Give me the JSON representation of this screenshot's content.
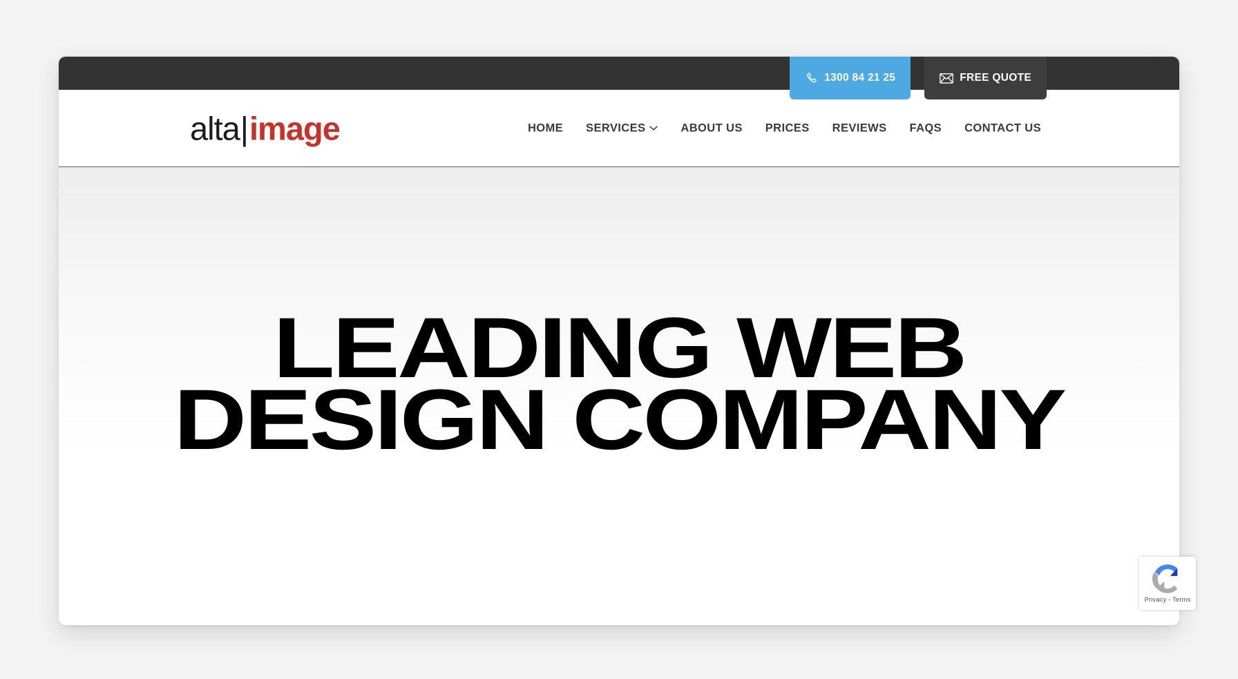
{
  "theme": {
    "page_background": "#f3f3f3",
    "card_background": "#ffffff",
    "topbar_background": "#333333",
    "phone_button_background": "#4ea9e2",
    "quote_button_background": "#3d3d3d",
    "logo_accent": "#c5332d",
    "nav_text": "#3a3a3a",
    "headline_color": "#000000"
  },
  "topbar": {
    "phone_button": {
      "label": "1300 84 21 25",
      "icon": "phone-icon"
    },
    "quote_button": {
      "label": "FREE QUOTE",
      "icon": "envelope-icon"
    }
  },
  "header": {
    "logo": {
      "part_one": "alta",
      "separator": "|",
      "part_two": "image"
    },
    "nav": [
      {
        "label": "HOME",
        "has_dropdown": false
      },
      {
        "label": "SERVICES",
        "has_dropdown": true,
        "dropdown_icon": "chevron-down-icon"
      },
      {
        "label": "ABOUT US",
        "has_dropdown": false
      },
      {
        "label": "PRICES",
        "has_dropdown": false
      },
      {
        "label": "REVIEWS",
        "has_dropdown": false
      },
      {
        "label": "FAQS",
        "has_dropdown": false
      },
      {
        "label": "CONTACT US",
        "has_dropdown": false
      }
    ]
  },
  "hero": {
    "headline_line_1": "LEADING WEB",
    "headline_line_2": "DESIGN COMPANY",
    "mark": "✕"
  },
  "recaptcha": {
    "icon": "recaptcha-icon",
    "text": "Privacy - Terms"
  }
}
